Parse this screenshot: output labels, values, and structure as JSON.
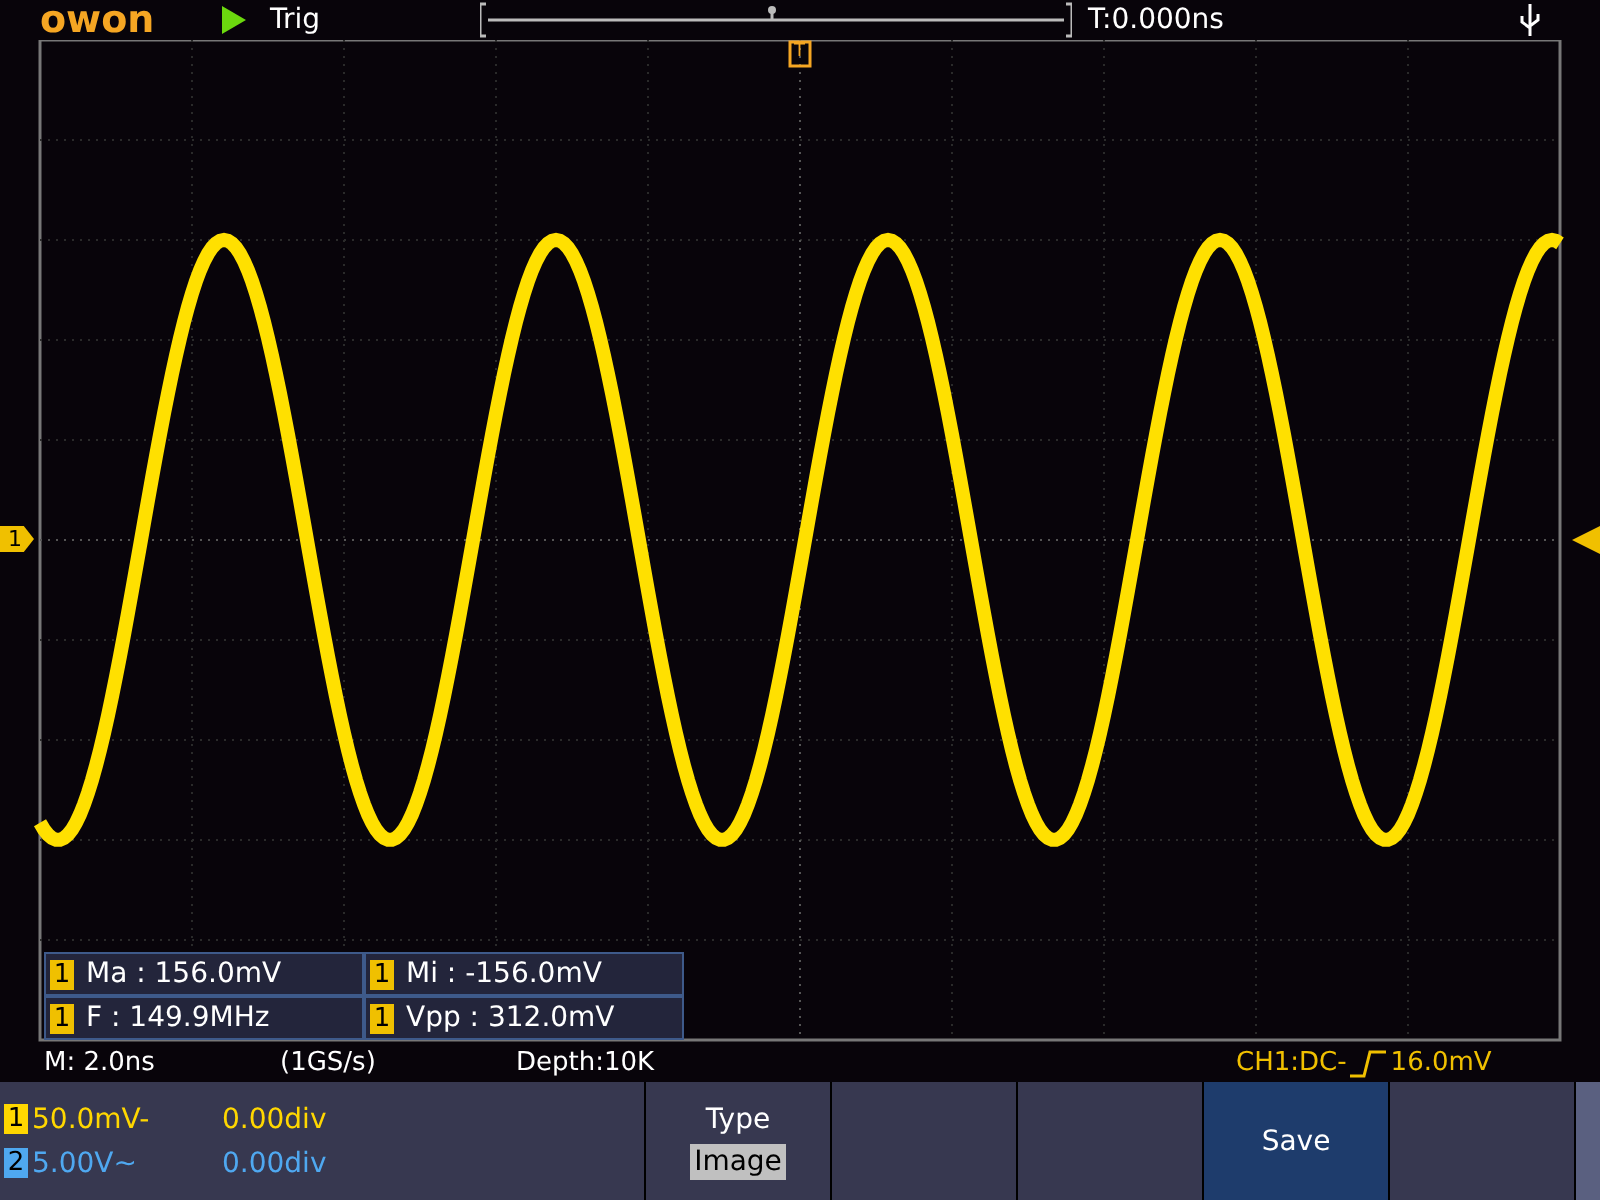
{
  "top_bar": {
    "logo": "owon",
    "running": true,
    "trigger_status": "Trig",
    "time_offset": "T:0.000ns"
  },
  "markers": {
    "trigger_position": "T",
    "channel_level": "1"
  },
  "measurements": [
    {
      "channel": "1",
      "text": "Ma : 156.0mV"
    },
    {
      "channel": "1",
      "text": "Mi : -156.0mV"
    },
    {
      "channel": "1",
      "text": "F : 149.9MHz"
    },
    {
      "channel": "1",
      "text": "Vpp : 312.0mV"
    }
  ],
  "status_bar": {
    "timebase": "M: 2.0ns",
    "sample_rate": "(1GS/s)",
    "depth": "Depth:10K",
    "trigger": "CH1:DC-",
    "trigger_level": "16.0mV"
  },
  "channels": [
    {
      "number": "1",
      "scale": "50.0mV-",
      "position": "0.00div",
      "color": "#ffd700"
    },
    {
      "number": "2",
      "scale": "5.00V~",
      "position": "0.00div",
      "color": "#4fa8f0"
    }
  ],
  "menu": [
    {
      "kind": "option",
      "label": "Type",
      "value": "Image",
      "selected": false
    },
    {
      "kind": "blank",
      "selected": false
    },
    {
      "kind": "blank",
      "selected": false
    },
    {
      "kind": "action",
      "label": "Save",
      "selected": true
    },
    {
      "kind": "blank",
      "selected": false
    }
  ]
}
